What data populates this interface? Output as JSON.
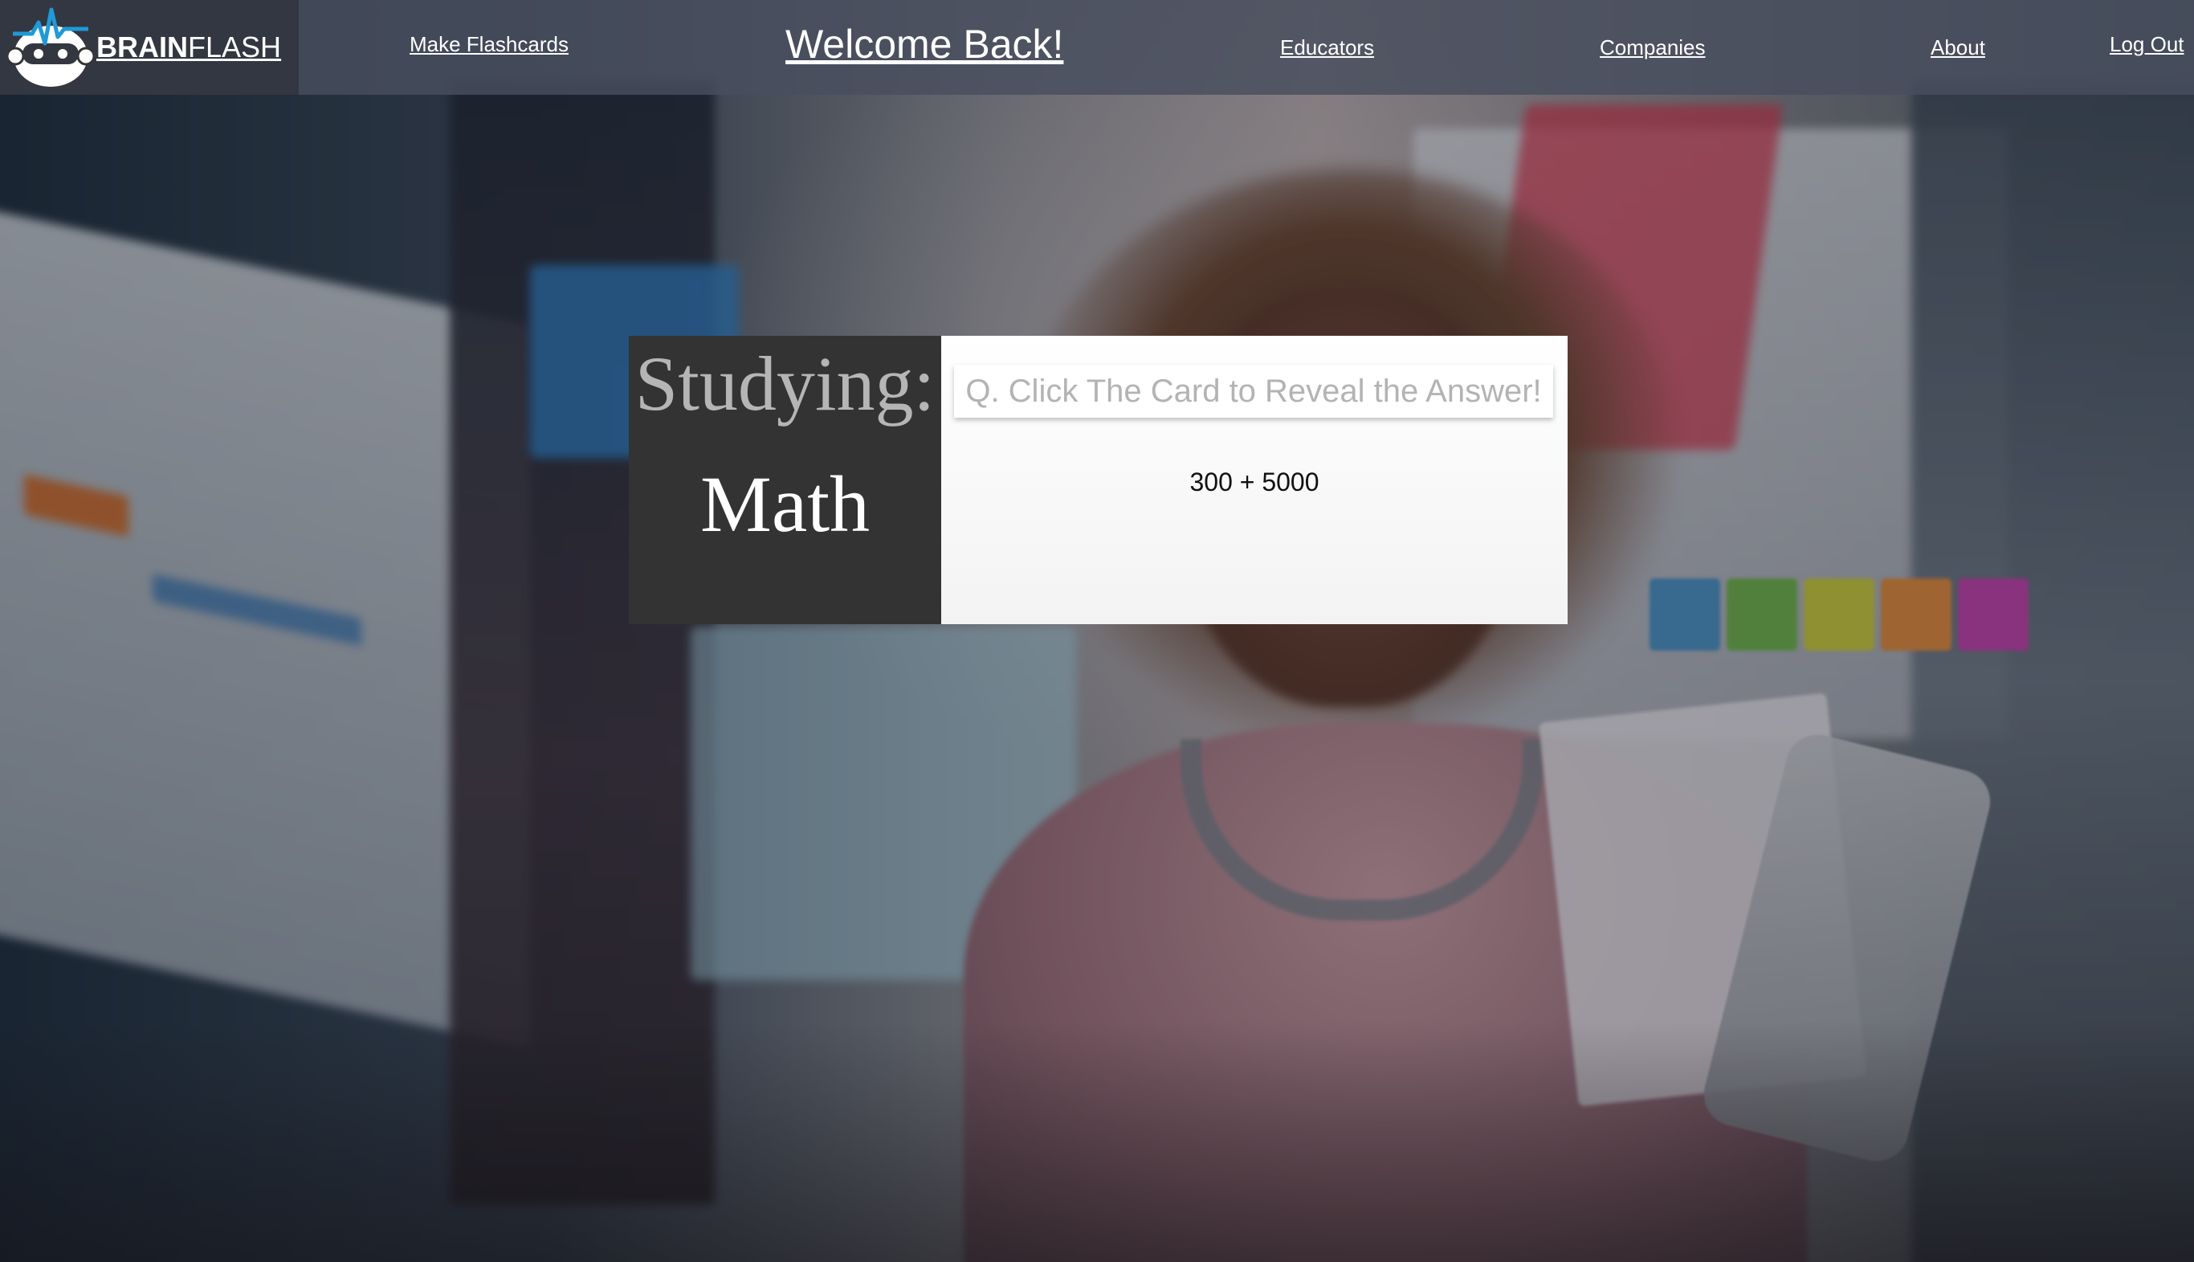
{
  "brand": {
    "name_bold": "BRAIN",
    "name_light": "FLASH",
    "logo_icon": "brain-robot-logo-icon"
  },
  "nav": {
    "make_flashcards": "Make Flashcards",
    "title": "Welcome Back!",
    "educators": "Educators",
    "companies": "Companies",
    "about": "About",
    "logout": "Log Out"
  },
  "study": {
    "heading": "Studying:",
    "subject": "Math"
  },
  "card": {
    "prompt": "Q. Click The Card to Reveal the Answer!",
    "question": "300 + 5000"
  },
  "colors": {
    "nav_bg": "#484e5e",
    "brand_bg": "#323640",
    "label_bg": "#333333",
    "logo_accent": "#1f9ad6"
  }
}
